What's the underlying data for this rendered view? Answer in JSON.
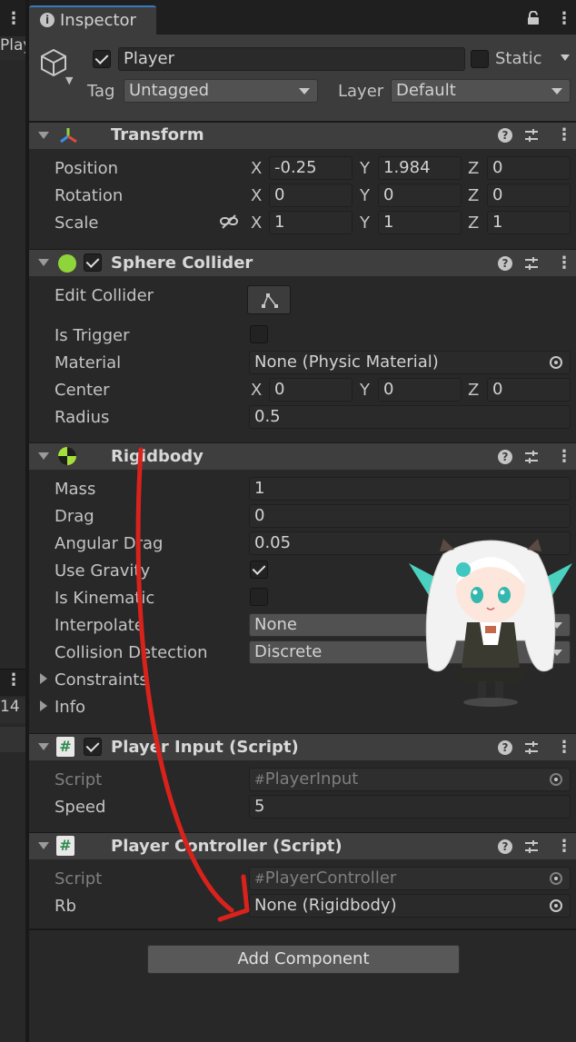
{
  "left_panel": {
    "tab_label": "Play",
    "row_number": "14"
  },
  "inspector": {
    "tab_title": "Inspector",
    "object": {
      "enabled": true,
      "name": "Player",
      "static_label": "Static",
      "static": false,
      "tag_label": "Tag",
      "tag_value": "Untagged",
      "layer_label": "Layer",
      "layer_value": "Default"
    },
    "transform": {
      "title": "Transform",
      "rows": [
        {
          "label": "Position",
          "x": "-0.25",
          "y": "1.984",
          "z": "0"
        },
        {
          "label": "Rotation",
          "x": "0",
          "y": "0",
          "z": "0"
        },
        {
          "label": "Scale",
          "x": "1",
          "y": "1",
          "z": "1"
        }
      ],
      "axis_x": "X",
      "axis_y": "Y",
      "axis_z": "Z"
    },
    "sphere_collider": {
      "title": "Sphere Collider",
      "enabled": true,
      "edit_label": "Edit Collider",
      "is_trigger_label": "Is Trigger",
      "is_trigger": false,
      "material_label": "Material",
      "material_value": "None (Physic Material)",
      "center_label": "Center",
      "center": {
        "x": "0",
        "y": "0",
        "z": "0"
      },
      "radius_label": "Radius",
      "radius": "0.5"
    },
    "rigidbody": {
      "title": "Rigidbody",
      "mass_label": "Mass",
      "mass": "1",
      "drag_label": "Drag",
      "drag": "0",
      "angular_drag_label": "Angular Drag",
      "angular_drag": "0.05",
      "use_gravity_label": "Use Gravity",
      "use_gravity": true,
      "is_kinematic_label": "Is Kinematic",
      "is_kinematic": false,
      "interpolate_label": "Interpolate",
      "interpolate": "None",
      "collision_label": "Collision Detection",
      "collision": "Discrete",
      "constraints_label": "Constraints",
      "info_label": "Info"
    },
    "player_input": {
      "title": "Player Input (Script)",
      "enabled": true,
      "script_label": "Script",
      "script_value": "PlayerInput",
      "speed_label": "Speed",
      "speed": "5"
    },
    "player_controller": {
      "title": "Player Controller (Script)",
      "script_label": "Script",
      "script_value": "PlayerController",
      "rb_label": "Rb",
      "rb_value": "None (Rigidbody)"
    },
    "add_component_label": "Add Component"
  },
  "colors": {
    "annotation_arrow": "#d9221c",
    "accent_tab": "#3a79bb",
    "rigidbody_icon": "#a5e03a",
    "collider_icon": "#8fd43a"
  }
}
